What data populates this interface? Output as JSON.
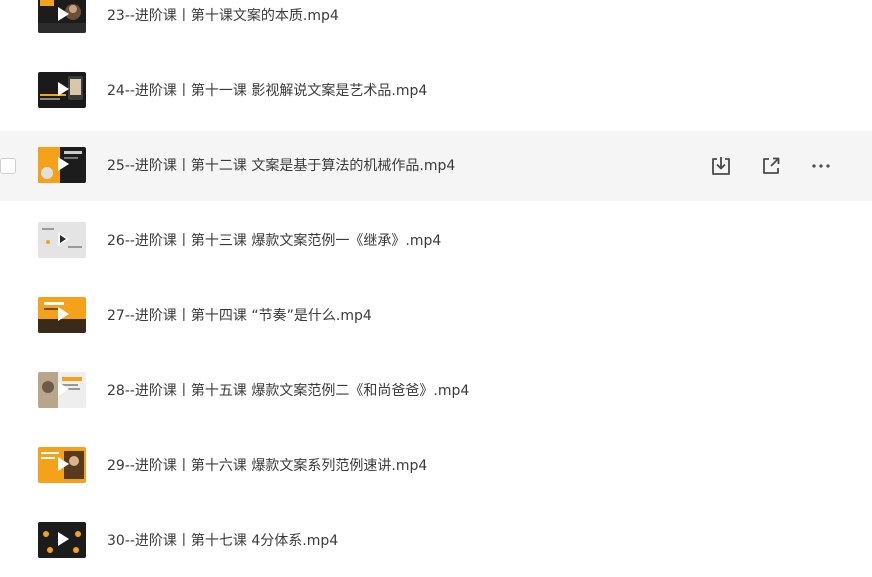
{
  "files": [
    {
      "name": "23--进阶课丨第十课文案的本质.mp4",
      "thumb": "thumb-dark-person"
    },
    {
      "name": "24--进阶课丨第十一课 影视解说文案是艺术品.mp4",
      "thumb": "thumb-dark-screen"
    },
    {
      "name": "25--进阶课丨第十二课 文案是基于算法的机械作品.mp4",
      "thumb": "thumb-orange-dark"
    },
    {
      "name": "26--进阶课丨第十三课 爆款文案范例一《继承》.mp4",
      "thumb": "thumb-light"
    },
    {
      "name": "27--进阶课丨第十四课 “节奏”是什么.mp4",
      "thumb": "thumb-orange"
    },
    {
      "name": "28--进阶课丨第十五课 爆款文案范例二《和尚爸爸》.mp4",
      "thumb": "thumb-light-photo"
    },
    {
      "name": "29--进阶课丨第十六课 爆款文案系列范例速讲.mp4",
      "thumb": "thumb-orange-video"
    },
    {
      "name": "30--进阶课丨第十七课 4分体系.mp4",
      "thumb": "thumb-dark-shapes"
    }
  ],
  "hover_actions": {
    "download_icon": "download-icon",
    "share_icon": "share-icon",
    "more_icon": "more-icon"
  },
  "colors": {
    "hover_row_bg": "#f5f5f5",
    "text": "#3a3a3a",
    "icon": "#5a5a5a",
    "thumb_orange": "#f5a21b",
    "thumb_dark": "#1c1c1c"
  }
}
